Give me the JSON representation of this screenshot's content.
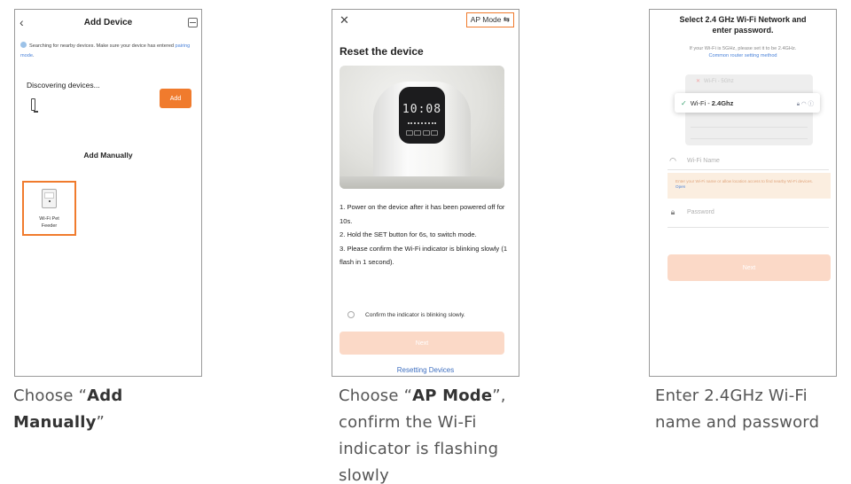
{
  "screens": {
    "add_device": {
      "back_icon": "chevron-left",
      "title": "Add Device",
      "scan_icon": "scan-frame",
      "search_text": "Searching for nearby devices. Make sure your device has entered",
      "search_link": "pairing mode",
      "search_end": ".",
      "discovering": "Discovering devices...",
      "add_button": "Add",
      "add_manually": "Add Manually",
      "tile_label_1": "Wi-Fi Pet",
      "tile_label_2": "Feeder",
      "accent": "#f07b2d"
    },
    "reset_device": {
      "close_icon": "close",
      "ap_mode": "AP Mode ⇆",
      "title": "Reset the device",
      "display_digits": "10:08",
      "steps": [
        "1. Power on the device after it has been powered off for 10s.",
        "2. Hold the SET button for 6s, to switch mode.",
        "3. Please confirm the Wi-Fi indicator is blinking slowly (1 flash in 1 second)."
      ],
      "confirm": "Confirm the indicator is blinking slowly.",
      "next": "Next",
      "resetting_link": "Resetting Devices"
    },
    "wifi": {
      "title_1": "Select 2.4 GHz Wi-Fi Network and",
      "title_2": "enter password.",
      "hint": "If your Wi-Fi is 5GHz, please set it to be 2.4GHz.",
      "hint_link": "Common router setting method",
      "bad_network": "Wi-Fi - 5Ghz",
      "good_prefix": "Wi-Fi -",
      "good_network": "2.4Ghz",
      "name_placeholder": "Wi-Fi Name",
      "warning": "Enter your Wi-Fi name or allow location access to find nearby Wi-Fi devices.",
      "warning_link": "Open",
      "password_placeholder": "Password",
      "next": "Next"
    }
  },
  "captions": {
    "c1_a": "Choose “",
    "c1_b": "Add",
    "c1_c": "Manually",
    "c1_d": "”",
    "c2_a": "Choose “",
    "c2_b": "AP Mode",
    "c2_c": "”,",
    "c2_d": "confirm the Wi-Fi",
    "c2_e": "indicator is flashing",
    "c2_f": "slowly",
    "c3_a": "Enter 2.4GHz Wi-Fi",
    "c3_b": "name and password"
  }
}
